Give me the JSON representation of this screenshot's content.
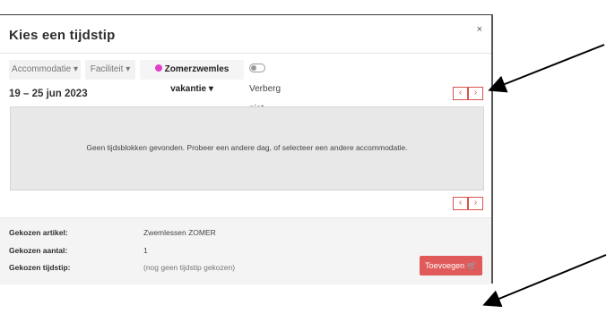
{
  "modal": {
    "title": "Kies een tijdstip",
    "close": "×"
  },
  "filters": {
    "accommodation": "Accommodatie ▾",
    "facility": "Faciliteit ▾",
    "selected_option": "Zomerzwemles vakantie ▾",
    "hide_unavailable": "Verberg niet beschikbaar"
  },
  "week": {
    "range": "19 – 25 jun 2023",
    "prev": "‹",
    "next": "›"
  },
  "empty_message": "Geen tijdsblokken gevonden. Probeer een andere dag, of selecteer een andere accommodatie.",
  "summary": {
    "article_label": "Gekozen artikel:",
    "article_value": "Zwemlessen ZOMER",
    "quantity_label": "Gekozen aantal:",
    "quantity_value": "1",
    "time_label": "Gekozen tijdstip:",
    "time_value": "(nog geen tijdstip gekozen)"
  },
  "add_button": "Toevoegen 🛒",
  "colors": {
    "accent": "#d9534f",
    "button": "#e05a5a",
    "option_dot": "#e040c8"
  }
}
